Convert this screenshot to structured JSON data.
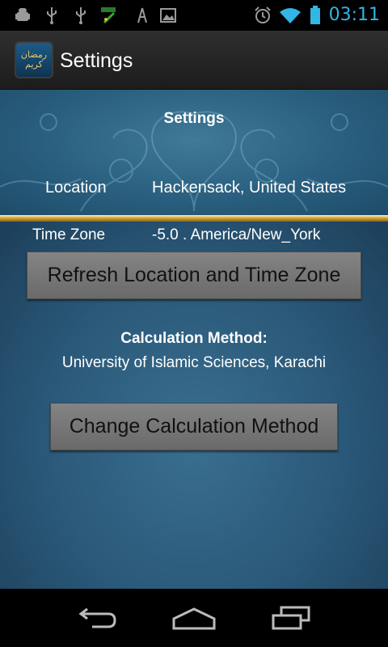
{
  "status_bar": {
    "time": "03:11",
    "icons": [
      "android-debug-icon",
      "usb-icon",
      "usb-icon",
      "fake-gps-icon",
      "signal-tower-icon",
      "image-icon",
      "alarm-icon",
      "wifi-icon",
      "battery-icon"
    ],
    "accent_color": "#33b5e5"
  },
  "action_bar": {
    "title": "Settings",
    "logo_text_line1": "رمضان",
    "logo_text_line2": "كريم"
  },
  "header": {
    "title": "Settings",
    "location_label": "Location",
    "location_value": "Hackensack, United States",
    "timezone_label": "Time Zone",
    "timezone_value": "-5.0 . America/New_York"
  },
  "main": {
    "refresh_button": "Refresh Location and Time Zone",
    "calc_method_label": "Calculation Method:",
    "calc_method_value": "University of Islamic Sciences, Karachi",
    "change_button": "Change Calculation Method"
  },
  "nav_bar": {
    "icons": [
      "back-icon",
      "home-icon",
      "recent-apps-icon"
    ]
  }
}
